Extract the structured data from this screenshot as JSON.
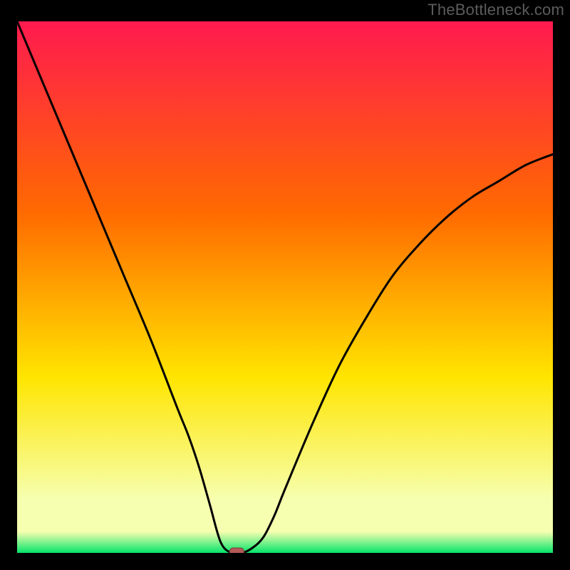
{
  "attribution": "TheBottleneck.com",
  "colors": {
    "bg": "#000000",
    "text": "#5c5c5c",
    "curve": "#000000",
    "marker_fill": "#b35a57",
    "marker_stroke": "#7c3a37",
    "grad_top": "#ff1a4f",
    "grad_mid1": "#ff6a00",
    "grad_mid2": "#ffe500",
    "grad_mid3": "#f6ffb0",
    "grad_bottom": "#06e46a"
  },
  "chart_data": {
    "type": "line",
    "title": "",
    "xlabel": "",
    "ylabel": "",
    "xlim": [
      0,
      100
    ],
    "ylim": [
      0,
      100
    ],
    "series": [
      {
        "name": "bottleneck-curve",
        "x": [
          0,
          5,
          10,
          15,
          20,
          25,
          30,
          32,
          34,
          36,
          38,
          40,
          42,
          44,
          46,
          48,
          50,
          55,
          60,
          65,
          70,
          75,
          80,
          85,
          90,
          95,
          100
        ],
        "values": [
          100,
          88,
          76,
          64,
          52,
          40,
          27,
          22,
          16,
          9,
          2,
          0,
          0,
          1,
          3,
          7,
          12,
          24,
          35,
          44,
          52,
          58,
          63,
          67,
          70,
          73,
          75
        ]
      }
    ],
    "optimum_x": 41,
    "optimum_y": 0
  }
}
